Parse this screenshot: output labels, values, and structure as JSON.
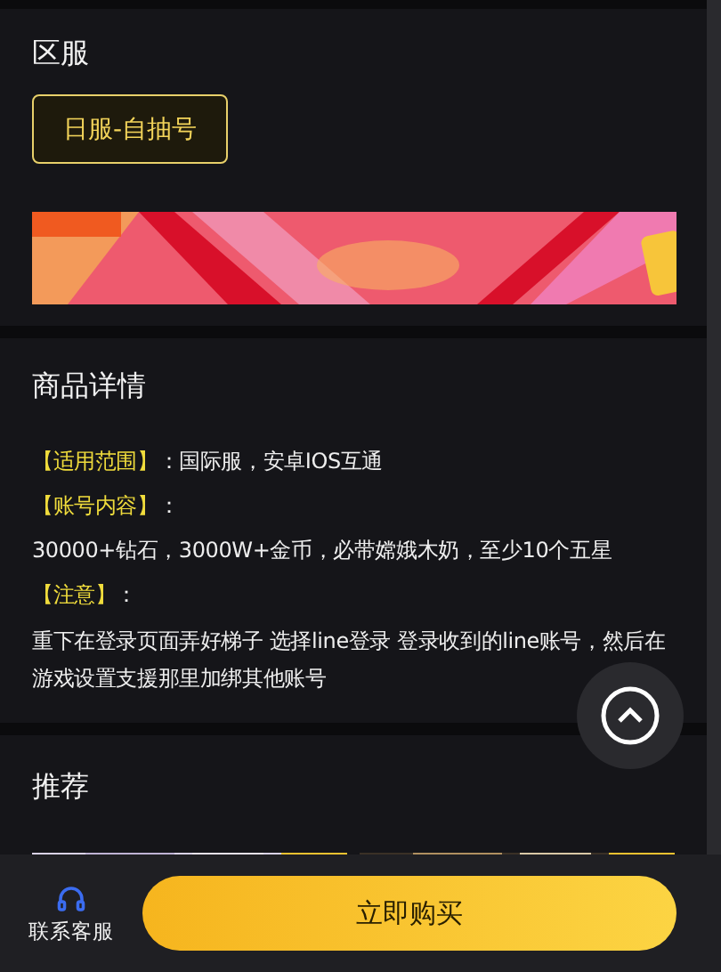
{
  "region": {
    "title": "区服",
    "options": [
      {
        "label": "日服-自抽号",
        "selected": true
      }
    ]
  },
  "details": {
    "title": "商品详情",
    "lines": [
      {
        "label": "【适用范围】",
        "text": "：国际服，安卓IOS互通"
      },
      {
        "label": "【账号内容】",
        "text": "："
      },
      {
        "text": "30000+钻石，3000W+金币，必带嫦娥木奶，至少10个五星"
      },
      {
        "label": "【注意】",
        "text": "："
      },
      {
        "text": "重下在登录页面弄好梯子 选择line登录 登录收到的line账号，然后在游戏设置支援那里加绑其他账号"
      }
    ]
  },
  "recommend": {
    "title": "推荐"
  },
  "bottom_bar": {
    "service_label": "联系客服",
    "buy_button": "立即购买"
  }
}
